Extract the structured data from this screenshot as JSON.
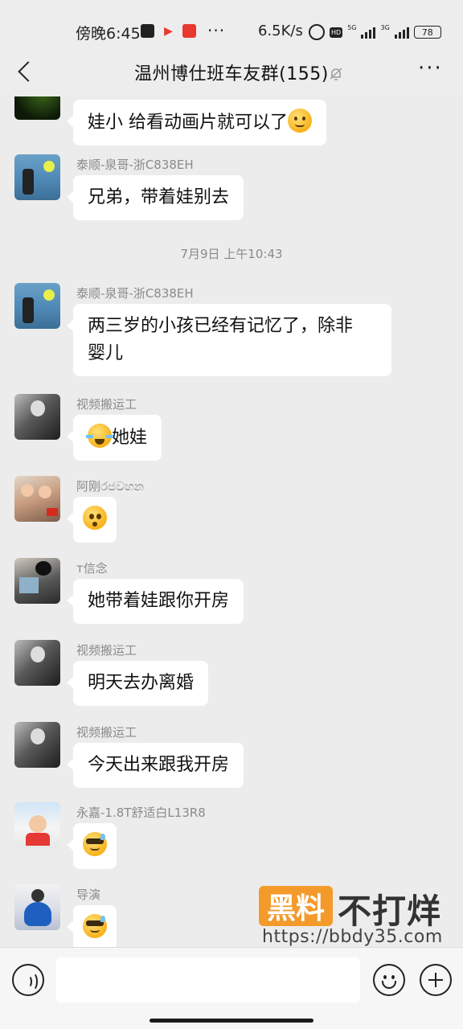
{
  "status_bar": {
    "time": "傍晚6:45",
    "more": "···",
    "speed": "6.5K/s",
    "hd": "HD",
    "gen1": "5G",
    "gen2": "3G",
    "battery": "78"
  },
  "header": {
    "title": "温州博仕班车友群(155)",
    "more": "···"
  },
  "messages": [
    {
      "sender": "",
      "text": "娃小 给看动画片就可以了",
      "emoji": "thinking-face"
    },
    {
      "sender": "泰顺-泉哥-浙C838EH",
      "text": "兄弟，带着娃别去"
    },
    {
      "timestamp": "7月9日 上午10:43"
    },
    {
      "sender": "泰顺-泉哥-浙C838EH",
      "text_line1": "两三岁的小孩已经有记忆了，除非",
      "text_line2": "婴儿"
    },
    {
      "sender": "视频搬运工",
      "text": "她娃",
      "emoji": "laughing-crying-face"
    },
    {
      "sender": "阿刚රජවහන",
      "emoji": "surprised-face"
    },
    {
      "sender": "т信念",
      "text": "她带着娃跟你开房"
    },
    {
      "sender": "视频搬运工",
      "text": "明天去办离婚"
    },
    {
      "sender": "视频搬运工",
      "text": "今天出来跟我开房"
    },
    {
      "sender": "永嘉-1.8T舒适白L13R8",
      "emoji": "sunglasses-sweat-face"
    },
    {
      "sender": "导演",
      "emoji": "sunglasses-sweat-face"
    }
  ],
  "watermark": {
    "box": "黑料",
    "text": "不打烊",
    "url": "https://bbdy35.com"
  },
  "input_bar": {
    "placeholder": ""
  },
  "colors": {
    "background": "#ececec",
    "bubble": "#ffffff",
    "sender_name": "#8a8a8a",
    "watermark_orange": "#f39a2a"
  }
}
